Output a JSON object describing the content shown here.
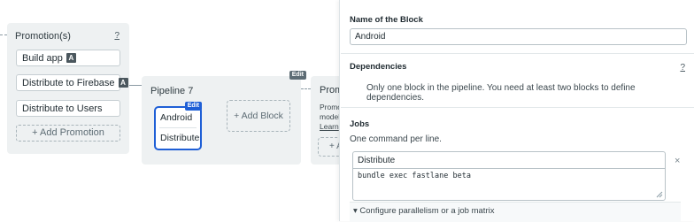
{
  "promotions": {
    "title": "Promotion(s)",
    "help": "?",
    "items": [
      {
        "label": "Build app",
        "badge": "A"
      },
      {
        "label": "Distribute to Firebase",
        "badge": "A"
      },
      {
        "label": "Distribute to Users"
      }
    ],
    "add_label": "+ Add Promotion"
  },
  "pipeline": {
    "title": "Pipeline 7",
    "edit_label": "Edit",
    "block": {
      "edit_label": "Edit",
      "name": "Android",
      "job": "Distribute"
    },
    "add_block_label": "+ Add Block"
  },
  "next_pipeline": {
    "title": "Prom",
    "text_lines": [
      "Promo",
      "model",
      "Learn"
    ],
    "add_partial": "+ A"
  },
  "editor": {
    "name_label": "Name of the Block",
    "name_value": "Android",
    "dependencies_label": "Dependencies",
    "dependencies_help": "?",
    "dependencies_text": "Only one block in the pipeline. You need at least two blocks to define dependencies.",
    "jobs_label": "Jobs",
    "jobs_hint": "One command per line.",
    "job_name": "Distribute",
    "job_command": "bundle exec fastlane beta",
    "close_symbol": "×",
    "config_label": "▾ Configure parallelism or a job matrix"
  }
}
